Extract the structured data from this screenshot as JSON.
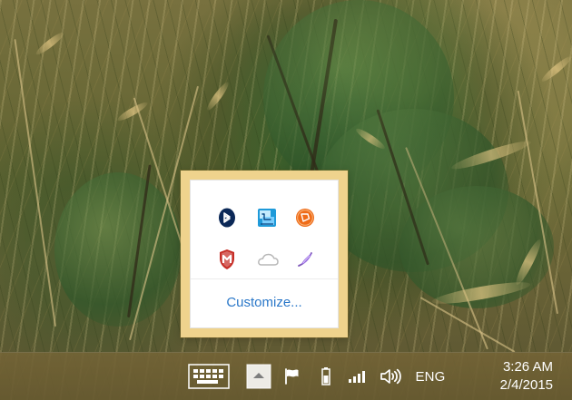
{
  "tray_popup": {
    "customize_label": "Customize...",
    "icons": [
      {
        "name": "bluetooth-icon"
      },
      {
        "name": "app-monitor-icon"
      },
      {
        "name": "orange-circle-icon"
      },
      {
        "name": "mcafee-icon"
      },
      {
        "name": "onedrive-icon"
      },
      {
        "name": "feather-icon"
      }
    ]
  },
  "taskbar": {
    "language": "ENG",
    "time": "3:26 AM",
    "date": "2/4/2015",
    "icons": [
      {
        "name": "keyboard-icon"
      },
      {
        "name": "chevron-up-icon"
      },
      {
        "name": "flag-icon"
      },
      {
        "name": "battery-icon"
      },
      {
        "name": "signal-bars-icon"
      },
      {
        "name": "speaker-icon"
      }
    ]
  },
  "colors": {
    "popup_border": "#efd38d",
    "panel_background": "#ffffff",
    "link_blue": "#2b78c9",
    "taskbar_background": "#6f5f34"
  }
}
